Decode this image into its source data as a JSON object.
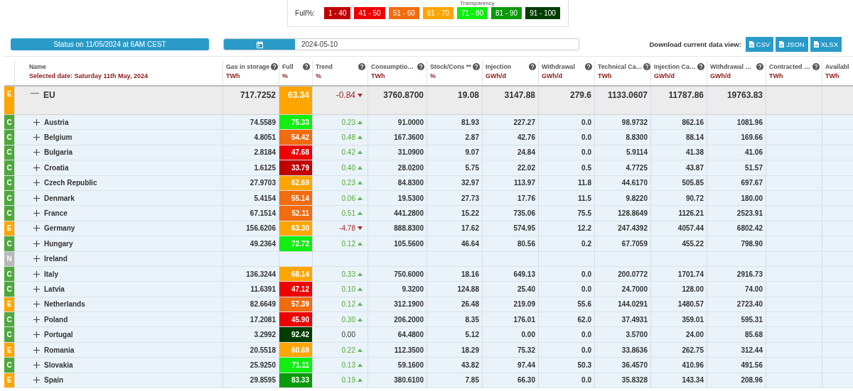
{
  "top_caption": "Transparency",
  "legend": {
    "label": "Full%:",
    "items": [
      {
        "label": "1 - 40",
        "color": "#c00000"
      },
      {
        "label": "41 - 50",
        "color": "#ee0000"
      },
      {
        "label": "51 - 60",
        "color": "#f26b0f"
      },
      {
        "label": "61 - 70",
        "color": "#ffa500"
      },
      {
        "label": "71 - 80",
        "color": "#11ee11"
      },
      {
        "label": "81 - 90",
        "color": "#0a9a0a"
      },
      {
        "label": "91 - 100",
        "color": "#003d00"
      }
    ]
  },
  "status_button": "Status on 11/05/2024 at 6AM CEST",
  "date_field": {
    "value": "2024-05-10"
  },
  "download": {
    "label": "Download current data view:",
    "buttons": [
      "CSV",
      "JSON",
      "XLSX"
    ]
  },
  "columns": [
    {
      "label": "Name",
      "unit": "Selected date: Saturday 11th May, 2024",
      "help": false
    },
    {
      "label": "Gas in storage",
      "unit": "TWh",
      "help": true
    },
    {
      "label": "Full",
      "unit": "%",
      "help": true
    },
    {
      "label": "Trend",
      "unit": "%",
      "help": true
    },
    {
      "label": "Consumptio…",
      "unit": "TWh",
      "help": true
    },
    {
      "label": "Stock/Cons **",
      "unit": "%",
      "help": true
    },
    {
      "label": "Injection",
      "unit": "GWh/d",
      "help": true
    },
    {
      "label": "Withdrawal",
      "unit": "GWh/d",
      "help": true
    },
    {
      "label": "Technical Ca…",
      "unit": "TWh",
      "help": true
    },
    {
      "label": "Injection Ca…",
      "unit": "GWh/d",
      "help": true
    },
    {
      "label": "Withdrawal …",
      "unit": "GWh/d",
      "help": true
    },
    {
      "label": "Contracted …",
      "unit": "TWh",
      "help": true
    },
    {
      "label": "Availabl",
      "unit": "TWh",
      "help": false
    }
  ],
  "rows": [
    {
      "kind": "total",
      "status": {
        "label": "E",
        "color": "#ffa500"
      },
      "name": "EU",
      "expanded": true,
      "full": {
        "value": "63.34",
        "color": "#ffa500"
      },
      "trend": {
        "value": "-0.84",
        "kind": "down"
      },
      "cells": [
        "717.7252",
        "3760.8700",
        "19.08",
        "3147.88",
        "279.6",
        "1133.0607",
        "11787.86",
        "19763.83"
      ]
    },
    {
      "kind": "country",
      "status": {
        "label": "C",
        "color": "#4fa83d"
      },
      "name": "Austria",
      "expanded": false,
      "full": {
        "value": "75.33",
        "color": "#11ee11"
      },
      "trend": {
        "value": "0.23",
        "kind": "up"
      },
      "cells": [
        "74.5589",
        "91.0000",
        "81.93",
        "227.27",
        "0.0",
        "98.9732",
        "862.16",
        "1081.96"
      ]
    },
    {
      "kind": "country",
      "status": {
        "label": "C",
        "color": "#4fa83d"
      },
      "name": "Belgium",
      "expanded": false,
      "full": {
        "value": "54.42",
        "color": "#f26b0f"
      },
      "trend": {
        "value": "0.48",
        "kind": "up"
      },
      "cells": [
        "4.8051",
        "167.3600",
        "2.87",
        "42.76",
        "0.0",
        "8.8300",
        "88.14",
        "169.66"
      ]
    },
    {
      "kind": "country",
      "status": {
        "label": "C",
        "color": "#4fa83d"
      },
      "name": "Bulgaria",
      "expanded": false,
      "full": {
        "value": "47.68",
        "color": "#ee0000"
      },
      "trend": {
        "value": "0.42",
        "kind": "up"
      },
      "cells": [
        "2.8184",
        "31.0900",
        "9.07",
        "24.84",
        "0.0",
        "5.9114",
        "41.38",
        "41.06"
      ]
    },
    {
      "kind": "country",
      "status": {
        "label": "C",
        "color": "#4fa83d"
      },
      "name": "Croatia",
      "expanded": false,
      "full": {
        "value": "33.79",
        "color": "#c00000"
      },
      "trend": {
        "value": "0.40",
        "kind": "up"
      },
      "cells": [
        "1.6125",
        "28.0200",
        "5.75",
        "22.02",
        "0.5",
        "4.7725",
        "43.87",
        "51.57"
      ]
    },
    {
      "kind": "country",
      "status": {
        "label": "C",
        "color": "#4fa83d"
      },
      "name": "Czech Republic",
      "expanded": false,
      "full": {
        "value": "62.69",
        "color": "#ffa500"
      },
      "trend": {
        "value": "0.23",
        "kind": "up"
      },
      "cells": [
        "27.9703",
        "84.8300",
        "32.97",
        "113.97",
        "11.8",
        "44.6170",
        "505.85",
        "697.67"
      ]
    },
    {
      "kind": "country",
      "status": {
        "label": "C",
        "color": "#4fa83d"
      },
      "name": "Denmark",
      "expanded": false,
      "full": {
        "value": "55.14",
        "color": "#f26b0f"
      },
      "trend": {
        "value": "0.06",
        "kind": "up"
      },
      "cells": [
        "5.4154",
        "19.5300",
        "27.73",
        "17.76",
        "11.5",
        "9.8220",
        "90.72",
        "180.00"
      ]
    },
    {
      "kind": "country",
      "status": {
        "label": "C",
        "color": "#4fa83d"
      },
      "name": "France",
      "expanded": false,
      "full": {
        "value": "52.11",
        "color": "#f26b0f"
      },
      "trend": {
        "value": "0.51",
        "kind": "up"
      },
      "cells": [
        "67.1514",
        "441.2800",
        "15.22",
        "735.06",
        "75.5",
        "128.8649",
        "1126.21",
        "2523.91"
      ]
    },
    {
      "kind": "country",
      "status": {
        "label": "E",
        "color": "#ffa500"
      },
      "name": "Germany",
      "expanded": false,
      "full": {
        "value": "63.30",
        "color": "#ffa500"
      },
      "trend": {
        "value": "-4.78",
        "kind": "down"
      },
      "cells": [
        "156.6206",
        "888.8300",
        "17.62",
        "574.95",
        "12.2",
        "247.4392",
        "4057.44",
        "6802.42"
      ]
    },
    {
      "kind": "country",
      "status": {
        "label": "C",
        "color": "#4fa83d"
      },
      "name": "Hungary",
      "expanded": false,
      "full": {
        "value": "72.72",
        "color": "#11ee11"
      },
      "trend": {
        "value": "0.12",
        "kind": "up"
      },
      "cells": [
        "49.2364",
        "105.5600",
        "46.64",
        "80.56",
        "0.2",
        "67.7059",
        "455.22",
        "798.90"
      ]
    },
    {
      "kind": "country",
      "status": {
        "label": "N",
        "color": "#b8b8b8"
      },
      "name": "Ireland",
      "expanded": false
    },
    {
      "kind": "country",
      "status": {
        "label": "C",
        "color": "#4fa83d"
      },
      "name": "Italy",
      "expanded": false,
      "full": {
        "value": "68.14",
        "color": "#ffa500"
      },
      "trend": {
        "value": "0.33",
        "kind": "up"
      },
      "cells": [
        "136.3244",
        "750.6000",
        "18.16",
        "649.13",
        "0.0",
        "200.0772",
        "1701.74",
        "2916.73"
      ]
    },
    {
      "kind": "country",
      "status": {
        "label": "C",
        "color": "#4fa83d"
      },
      "name": "Latvia",
      "expanded": false,
      "full": {
        "value": "47.12",
        "color": "#ee0000"
      },
      "trend": {
        "value": "0.10",
        "kind": "up"
      },
      "cells": [
        "11.6391",
        "9.3200",
        "124.88",
        "25.40",
        "0.0",
        "24.7000",
        "128.00",
        "74.00"
      ]
    },
    {
      "kind": "country",
      "status": {
        "label": "E",
        "color": "#ffa500"
      },
      "name": "Netherlands",
      "expanded": false,
      "full": {
        "value": "57.39",
        "color": "#f26b0f"
      },
      "trend": {
        "value": "0.12",
        "kind": "up"
      },
      "cells": [
        "82.6649",
        "312.1900",
        "26.48",
        "219.09",
        "55.6",
        "144.0291",
        "1480.57",
        "2723.40"
      ]
    },
    {
      "kind": "country",
      "status": {
        "label": "C",
        "color": "#4fa83d"
      },
      "name": "Poland",
      "expanded": false,
      "full": {
        "value": "45.90",
        "color": "#ee0000"
      },
      "trend": {
        "value": "0.30",
        "kind": "up"
      },
      "cells": [
        "17.2081",
        "206.2000",
        "8.35",
        "176.01",
        "62.0",
        "37.4931",
        "359.01",
        "595.31"
      ]
    },
    {
      "kind": "country",
      "status": {
        "label": "C",
        "color": "#4fa83d"
      },
      "name": "Portugal",
      "expanded": false,
      "full": {
        "value": "92.42",
        "color": "#003d00"
      },
      "trend": {
        "value": "0.00",
        "kind": "flat"
      },
      "cells": [
        "3.2992",
        "64.4800",
        "5.12",
        "0.00",
        "0.0",
        "3.5700",
        "24.00",
        "85.68"
      ]
    },
    {
      "kind": "country",
      "status": {
        "label": "E",
        "color": "#ffa500"
      },
      "name": "Romania",
      "expanded": false,
      "full": {
        "value": "60.69",
        "color": "#ffa500"
      },
      "trend": {
        "value": "0.22",
        "kind": "up"
      },
      "cells": [
        "20.5518",
        "112.3500",
        "18.29",
        "75.32",
        "0.0",
        "33.8636",
        "262.75",
        "312.44"
      ]
    },
    {
      "kind": "country",
      "status": {
        "label": "C",
        "color": "#4fa83d"
      },
      "name": "Slovakia",
      "expanded": false,
      "full": {
        "value": "71.11",
        "color": "#11ee11"
      },
      "trend": {
        "value": "0.13",
        "kind": "up"
      },
      "cells": [
        "25.9250",
        "59.1600",
        "43.82",
        "97.44",
        "50.3",
        "36.4570",
        "410.96",
        "491.56"
      ]
    },
    {
      "kind": "country",
      "status": {
        "label": "E",
        "color": "#ffa500"
      },
      "name": "Spain",
      "expanded": false,
      "full": {
        "value": "83.33",
        "color": "#0a9a0a"
      },
      "trend": {
        "value": "0.19",
        "kind": "up"
      },
      "cells": [
        "29.8595",
        "380.6100",
        "7.85",
        "66.30",
        "0.0",
        "35.8328",
        "143.34",
        "208.96"
      ]
    }
  ]
}
